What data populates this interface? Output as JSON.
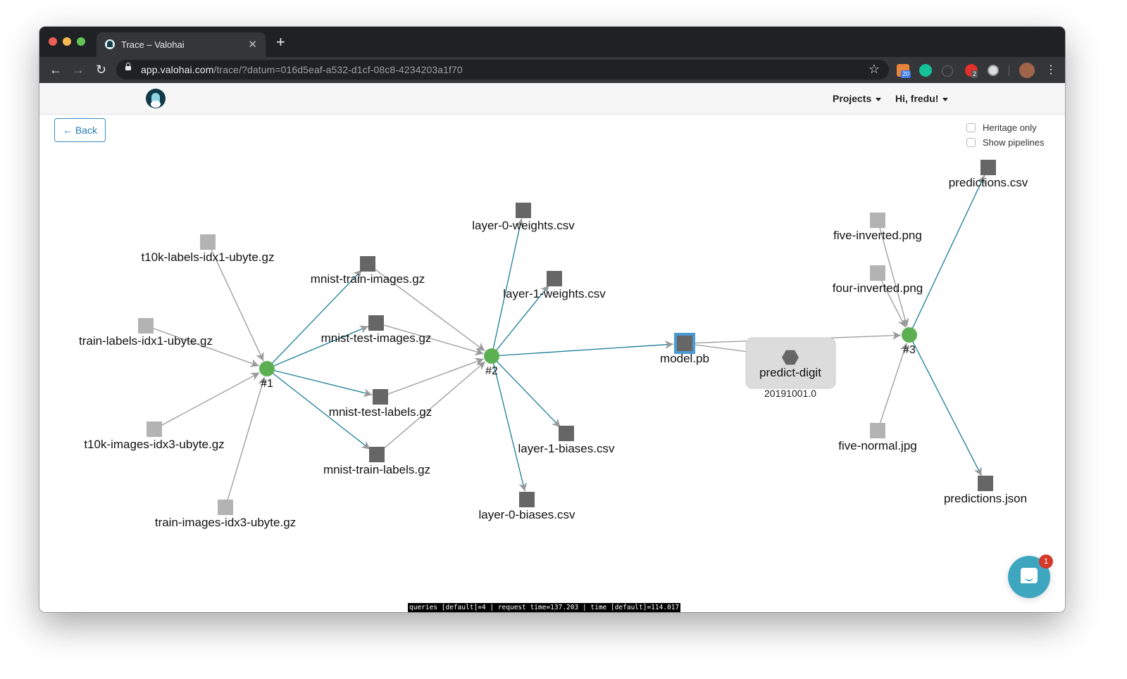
{
  "browser": {
    "tab_title": "Trace – Valohai",
    "url_host": "app.valohai.com",
    "url_path": "/trace/?datum=016d5eaf-a532-d1cf-08c8-4234203a1f70",
    "extension_badges": {
      "ext1": "20",
      "ext4": "2"
    }
  },
  "navbar": {
    "projects_label": "Projects",
    "user_label": "Hi, fredu!"
  },
  "back_label": "← Back",
  "options": {
    "heritage_only": "Heritage only",
    "show_pipelines": "Show pipelines"
  },
  "colors": {
    "execution": "#5cb052",
    "input_file": "#b3b3b3",
    "output_file": "#666666",
    "output_edge": "#1a7c97",
    "input_edge": "#999999",
    "selected": "#4a9ad4"
  },
  "graph": {
    "nodes": [
      {
        "id": "e1",
        "type": "execution",
        "label": "#1"
      },
      {
        "id": "e2",
        "type": "execution",
        "label": "#2"
      },
      {
        "id": "e3",
        "type": "execution",
        "label": "#3"
      },
      {
        "id": "f1",
        "type": "input",
        "label": "t10k-labels-idx1-ubyte.gz"
      },
      {
        "id": "f2",
        "type": "input",
        "label": "train-labels-idx1-ubyte.gz"
      },
      {
        "id": "f3",
        "type": "input",
        "label": "t10k-images-idx3-ubyte.gz"
      },
      {
        "id": "f4",
        "type": "input",
        "label": "train-images-idx3-ubyte.gz"
      },
      {
        "id": "f5",
        "type": "output",
        "label": "mnist-train-images.gz"
      },
      {
        "id": "f6",
        "type": "output",
        "label": "mnist-test-images.gz"
      },
      {
        "id": "f7",
        "type": "output",
        "label": "mnist-test-labels.gz"
      },
      {
        "id": "f8",
        "type": "output",
        "label": "mnist-train-labels.gz"
      },
      {
        "id": "f9",
        "type": "output",
        "label": "layer-0-weights.csv"
      },
      {
        "id": "f10",
        "type": "output",
        "label": "layer-1-weights.csv"
      },
      {
        "id": "f11",
        "type": "output",
        "label": "layer-1-biases.csv"
      },
      {
        "id": "f12",
        "type": "output",
        "label": "layer-0-biases.csv"
      },
      {
        "id": "f13",
        "type": "selected",
        "label": "model.pb"
      },
      {
        "id": "d1",
        "type": "deployment",
        "label": "predict-digit",
        "sublabel": "20191001.0"
      },
      {
        "id": "f14",
        "type": "input",
        "label": "five-inverted.png"
      },
      {
        "id": "f15",
        "type": "input",
        "label": "four-inverted.png"
      },
      {
        "id": "f16",
        "type": "input",
        "label": "five-normal.jpg"
      },
      {
        "id": "f17",
        "type": "output",
        "label": "predictions.csv"
      },
      {
        "id": "f18",
        "type": "output",
        "label": "predictions.json"
      }
    ],
    "edges": [
      {
        "from": "f1",
        "to": "e1",
        "kind": "input"
      },
      {
        "from": "f2",
        "to": "e1",
        "kind": "input"
      },
      {
        "from": "f3",
        "to": "e1",
        "kind": "input"
      },
      {
        "from": "f4",
        "to": "e1",
        "kind": "input"
      },
      {
        "from": "e1",
        "to": "f5",
        "kind": "output"
      },
      {
        "from": "e1",
        "to": "f6",
        "kind": "output"
      },
      {
        "from": "e1",
        "to": "f7",
        "kind": "output"
      },
      {
        "from": "e1",
        "to": "f8",
        "kind": "output"
      },
      {
        "from": "f5",
        "to": "e2",
        "kind": "input"
      },
      {
        "from": "f6",
        "to": "e2",
        "kind": "input"
      },
      {
        "from": "f7",
        "to": "e2",
        "kind": "input"
      },
      {
        "from": "f8",
        "to": "e2",
        "kind": "input"
      },
      {
        "from": "e2",
        "to": "f9",
        "kind": "output"
      },
      {
        "from": "e2",
        "to": "f10",
        "kind": "output"
      },
      {
        "from": "e2",
        "to": "f11",
        "kind": "output"
      },
      {
        "from": "e2",
        "to": "f12",
        "kind": "output"
      },
      {
        "from": "e2",
        "to": "f13",
        "kind": "output"
      },
      {
        "from": "f13",
        "to": "d1",
        "kind": "input"
      },
      {
        "from": "f13",
        "to": "e3",
        "kind": "input"
      },
      {
        "from": "f14",
        "to": "e3",
        "kind": "input"
      },
      {
        "from": "f15",
        "to": "e3",
        "kind": "input"
      },
      {
        "from": "f16",
        "to": "e3",
        "kind": "input"
      },
      {
        "from": "e3",
        "to": "f17",
        "kind": "output"
      },
      {
        "from": "e3",
        "to": "f18",
        "kind": "output"
      }
    ]
  },
  "status_bar": "queries [default]=4 | request time=137.203 | time [default]=114.017",
  "chat": {
    "badge": "1"
  }
}
